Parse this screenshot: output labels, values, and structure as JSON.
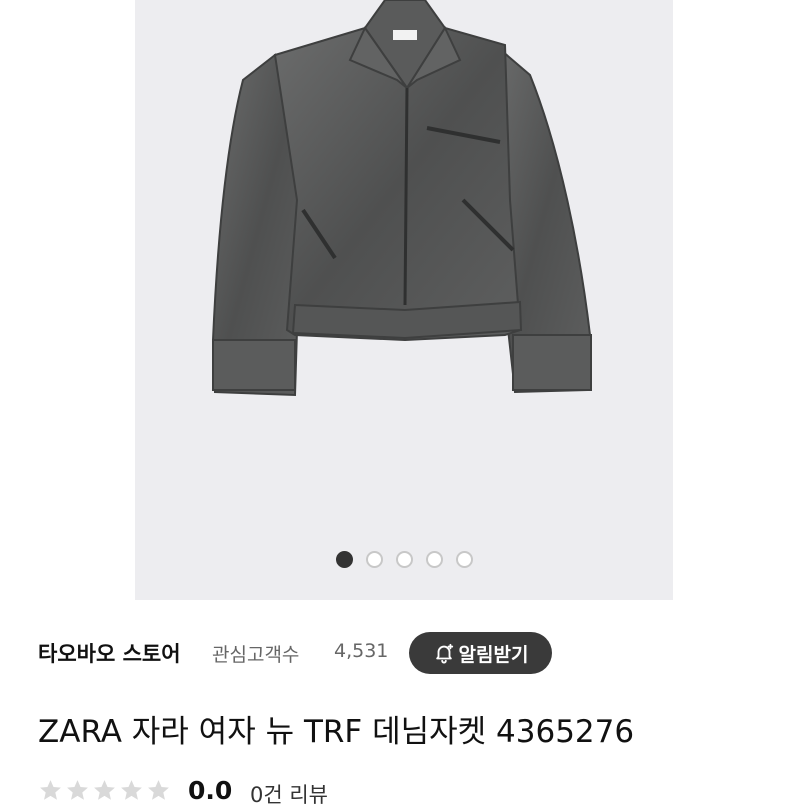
{
  "product": {
    "image_alt": "ZARA denim jacket",
    "carousel": {
      "total": 5,
      "active_index": 0
    },
    "store": {
      "name": "타오바오 스토어",
      "followers_label": "관심고객수",
      "followers_count": "4,531",
      "alert_button_label": "알림받기"
    },
    "title": "ZARA 자라 여자 뉴 TRF 데님자켓 4365276",
    "rating": {
      "stars": 0,
      "max_stars": 5,
      "value": "0.0",
      "review_count_label": "0건 리뷰"
    }
  },
  "icons": {
    "alert": "bell-plus-icon",
    "star": "star-icon"
  },
  "colors": {
    "button_bg": "#3a3a3a",
    "dot_active": "#333333",
    "star_empty": "#d9d9d9",
    "image_bg": "#ededf0"
  }
}
